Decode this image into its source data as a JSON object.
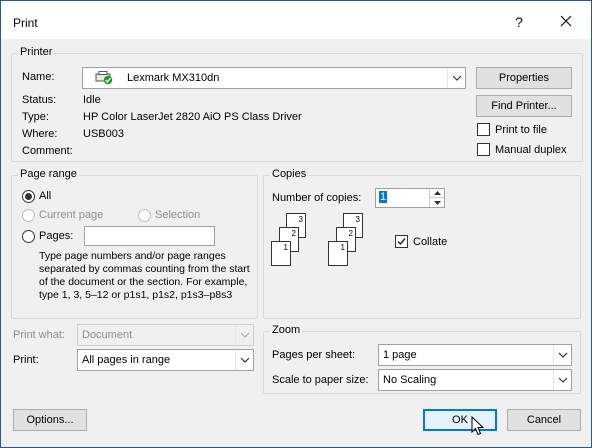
{
  "window": {
    "title": "Print",
    "help": "?",
    "close": "✕"
  },
  "printer": {
    "group_title": "Printer",
    "name_label": "Name:",
    "name_value": "Lexmark MX310dn",
    "status_label": "Status:",
    "status_value": "Idle",
    "type_label": "Type:",
    "type_value": "HP Color LaserJet 2820 AiO PS Class Driver",
    "where_label": "Where:",
    "where_value": "USB003",
    "comment_label": "Comment:",
    "comment_value": "",
    "properties_button": "Properties",
    "find_printer_button": "Find Printer...",
    "print_to_file_label": "Print to file",
    "print_to_file_checked": false,
    "manual_duplex_label": "Manual duplex",
    "manual_duplex_checked": false
  },
  "page_range": {
    "group_title": "Page range",
    "all_label": "All",
    "current_page_label": "Current page",
    "selection_label": "Selection",
    "pages_label": "Pages:",
    "pages_value": "",
    "help_text": "Type page numbers and/or page ranges separated by commas counting from the start of the document or the section. For example, type 1, 3, 5–12 or p1s1, p1s2, p1s3–p8s3",
    "selected": "All"
  },
  "copies": {
    "group_title": "Copies",
    "number_label": "Number of copies:",
    "number_value": "1",
    "collate_label": "Collate",
    "collate_checked": true
  },
  "print_what": {
    "label": "Print what:",
    "value": "Document"
  },
  "print": {
    "label": "Print:",
    "value": "All pages in range"
  },
  "zoom": {
    "group_title": "Zoom",
    "pages_per_sheet_label": "Pages per sheet:",
    "pages_per_sheet_value": "1 page",
    "scale_label": "Scale to paper size:",
    "scale_value": "No Scaling"
  },
  "buttons": {
    "options": "Options...",
    "ok": "OK",
    "cancel": "Cancel"
  },
  "colors": {
    "accent": "#0078d7",
    "dialog_bg": "#f0f0f0",
    "printer_ok": "#1e9e1e"
  }
}
